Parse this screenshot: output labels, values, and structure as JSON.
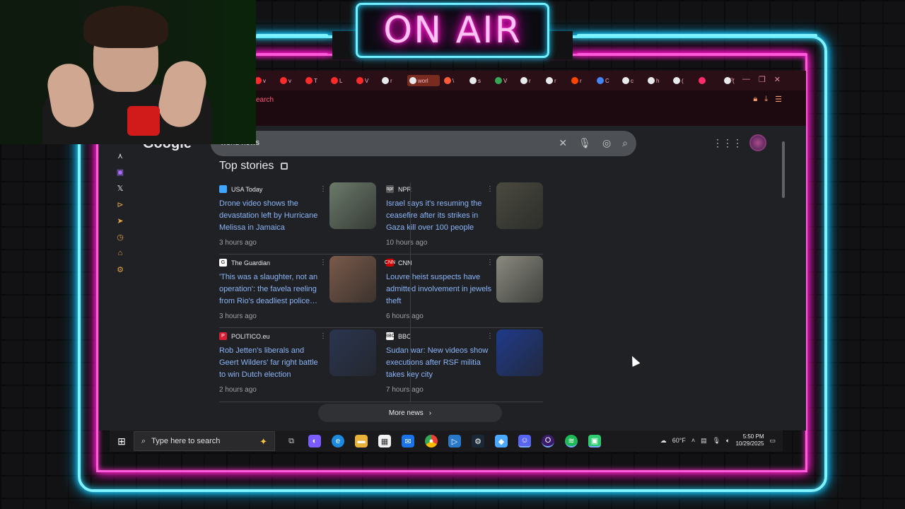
{
  "overlay": {
    "on_air_text": "ON AIR",
    "neon_cyan": "#7ff3ff",
    "neon_pink": "#ff5ad9"
  },
  "browser": {
    "tabs": [
      {
        "label": "v",
        "color": "#ff2b2b"
      },
      {
        "label": "v",
        "color": "#ff2b2b"
      },
      {
        "label": "T",
        "color": "#ff2b2b"
      },
      {
        "label": "L",
        "color": "#ff2b2b"
      },
      {
        "label": "V",
        "color": "#ff2b2b"
      },
      {
        "label": "r",
        "color": "#e8eaed"
      },
      {
        "label": "worl",
        "color": "#e8eaed",
        "active": true
      },
      {
        "label": "\\",
        "color": "#ff5a3c"
      },
      {
        "label": "s",
        "color": "#e8eaed"
      },
      {
        "label": "V",
        "color": "#34a853"
      },
      {
        "label": "r",
        "color": "#e8eaed"
      },
      {
        "label": "r",
        "color": "#e8eaed"
      },
      {
        "label": "r",
        "color": "#ff4500"
      },
      {
        "label": "C",
        "color": "#4285f4"
      },
      {
        "label": "c",
        "color": "#e8eaed"
      },
      {
        "label": "h",
        "color": "#e8eaed"
      },
      {
        "label": "(",
        "color": "#e8eaed"
      },
      {
        "label": "",
        "color": "#ff2b6b"
      },
      {
        "label": "(",
        "color": "#e8eaed"
      }
    ],
    "toolbar_search_label": "earch",
    "google_logo": "Google",
    "search_query": "world news",
    "top_stories_label": "Top stories",
    "more_news_label": "More news",
    "stories": [
      {
        "source": "USA Today",
        "source_color": "#3ea6ff",
        "source_glyph": "",
        "headline": "Drone video shows the devastation left by Hurricane Melissa in Jamaica",
        "time": "3 hours ago",
        "thumb": "#6b7a6a"
      },
      {
        "source": "NPR",
        "source_color": "#555555",
        "source_glyph": "npr",
        "headline": "Israel says it's resuming the ceasefire after its strikes in Gaza kill over 100 people",
        "time": "10 hours ago",
        "thumb": "#4a4a40"
      },
      {
        "source": "The Guardian",
        "source_color": "#ffffff",
        "source_glyph": "G",
        "headline": "'This was a slaughter, not an operation': the favela reeling from Rio's deadliest police…",
        "time": "3 hours ago",
        "thumb": "#7a5a4a"
      },
      {
        "source": "CNN",
        "source_color": "#cc0000",
        "source_glyph": "CNN",
        "headline": "Louvre heist suspects have admitted involvement in jewels theft",
        "time": "6 hours ago",
        "thumb": "#8a8a80"
      },
      {
        "source": "POLITICO.eu",
        "source_color": "#d91e36",
        "source_glyph": "P",
        "headline": "Rob Jetten's liberals and Geert Wilders' far right battle to win Dutch election",
        "time": "2 hours ago",
        "thumb": "#2a3550"
      },
      {
        "source": "BBC",
        "source_color": "#ffffff",
        "source_glyph": "BBC",
        "headline": "Sudan war: New videos show executions after RSF militia takes key city",
        "time": "7 hours ago",
        "thumb": "#1f3a8a"
      }
    ]
  },
  "taskbar": {
    "search_placeholder": "Type here to search",
    "weather": "60°F",
    "time": "5:50 PM",
    "date": "10/29/2025"
  }
}
